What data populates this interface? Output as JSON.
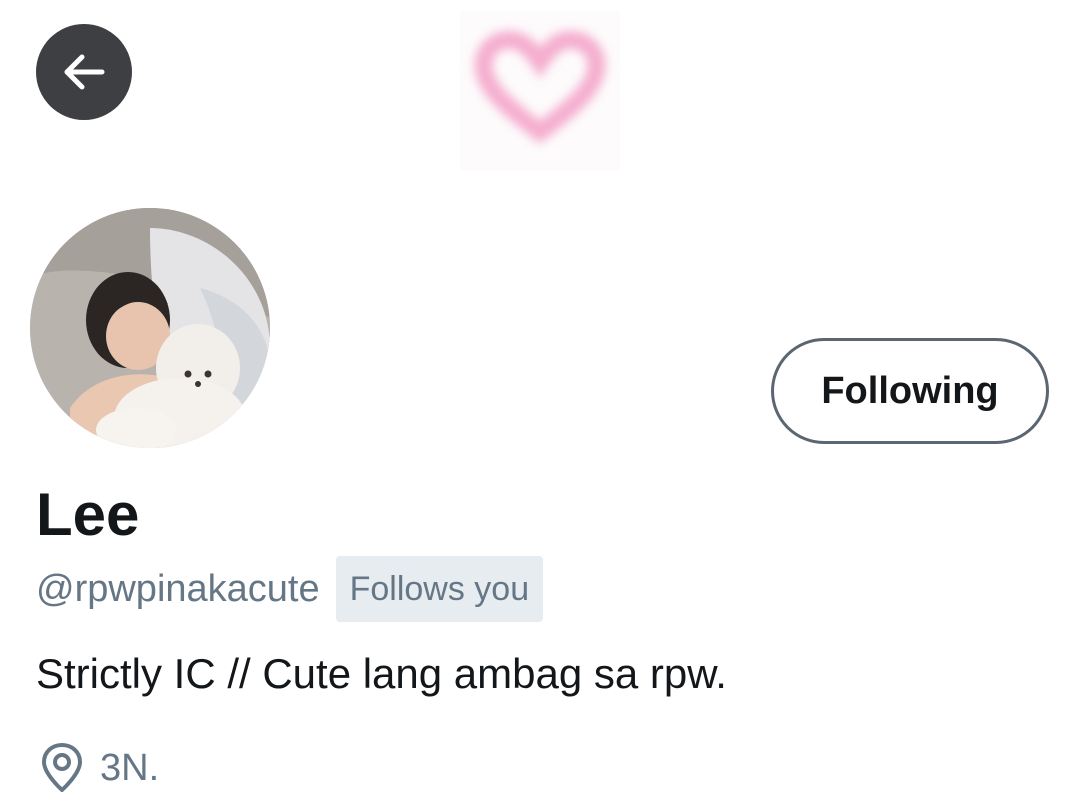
{
  "header": {
    "back_icon": "arrow-left-icon",
    "banner_icon": "heart-icon",
    "banner_color": "#f4a6c9"
  },
  "profile": {
    "avatar_icon": "avatar-photo",
    "follow_button_label": "Following",
    "display_name": "Lee",
    "handle": "@rpwpinakacute",
    "follows_you_badge": "Follows you",
    "bio": "Strictly IC // Cute lang ambag sa rpw.",
    "location_icon": "location-pin-icon",
    "location": "3N."
  },
  "colors": {
    "text_primary": "#14171a",
    "text_secondary": "#657786",
    "badge_background": "#e6ecf0",
    "back_button_background": "#3d3f42"
  }
}
